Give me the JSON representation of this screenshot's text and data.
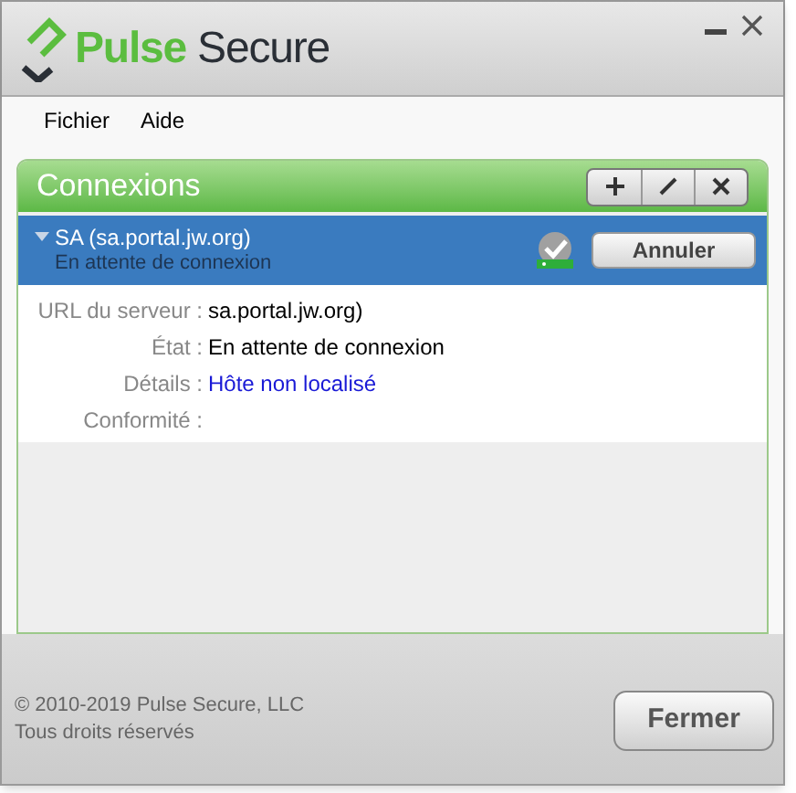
{
  "logo": {
    "brand": "Pulse",
    "product": "Secure"
  },
  "menu": [
    "Fichier",
    "Aide"
  ],
  "connections": {
    "title": "Connexions",
    "tools": [
      {
        "kind": "add"
      },
      {
        "kind": "edit"
      },
      {
        "kind": "delete"
      }
    ],
    "items": [
      {
        "name": "SA (sa.portal.jw.org)",
        "status": "En attente de connexion",
        "expanded": true,
        "selected": true,
        "action": "Annuler"
      }
    ],
    "details": [
      {
        "label": "URL du serveur :",
        "value": "sa.portal.jw.org)",
        "kind": "plain"
      },
      {
        "label": "État :",
        "value": "En attente de connexion",
        "kind": "plain"
      },
      {
        "label": "Détails :",
        "value": "Hôte non localisé",
        "kind": "link"
      },
      {
        "label": "Conformité :"
      }
    ]
  },
  "footer": {
    "copyright": "© 2010-2019 Pulse Secure, LLC",
    "rights": "Tous droits réservés",
    "button": "Fermer"
  }
}
